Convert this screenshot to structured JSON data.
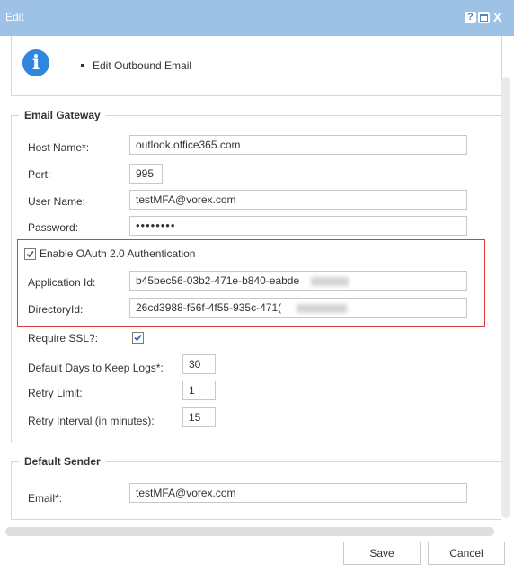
{
  "window": {
    "title": "Edit",
    "help_label": "?",
    "close_label": "X"
  },
  "info": {
    "item": "Edit Outbound Email"
  },
  "gateway": {
    "legend": "Email Gateway",
    "host_label": "Host Name*:",
    "host_value": "outlook.office365.com",
    "port_label": "Port:",
    "port_value": "995",
    "user_label": "User Name:",
    "user_value": "testMFA@vorex.com",
    "password_label": "Password:",
    "password_value": "••••••••",
    "oauth_label": "Enable OAuth 2.0 Authentication",
    "oauth_checked": true,
    "app_id_label": "Application Id:",
    "app_id_value": "b45bec56-03b2-471e-b840-eabde",
    "dir_id_label": "DirectoryId:",
    "dir_id_value": "26cd3988-f56f-4f55-935c-471(",
    "ssl_label": "Require SSL?:",
    "ssl_checked": true,
    "days_label": "Default Days to Keep Logs*:",
    "days_value": "30",
    "retry_label": "Retry Limit:",
    "retry_value": "1",
    "interval_label": "Retry Interval (in minutes):",
    "interval_value": "15"
  },
  "sender": {
    "legend": "Default Sender",
    "email_label": "Email*:",
    "email_value": "testMFA@vorex.com"
  },
  "footer": {
    "save_label": "Save",
    "cancel_label": "Cancel"
  },
  "colors": {
    "titlebar": "#9ec1e6",
    "info_icon": "#2e86de",
    "highlight_border": "#e03a3a",
    "checkbox_mark": "#3b6ea8"
  }
}
